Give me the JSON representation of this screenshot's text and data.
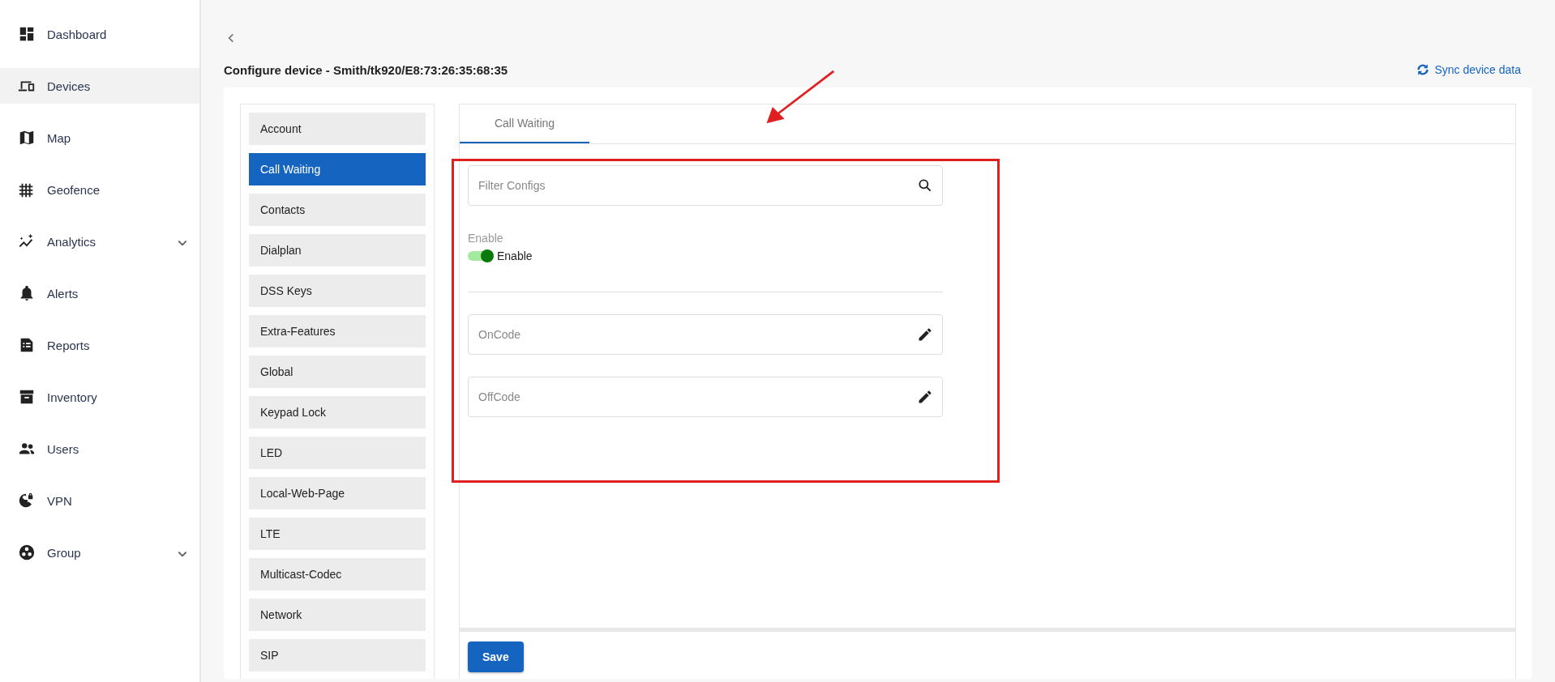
{
  "sidebar": {
    "items": [
      {
        "label": "Dashboard",
        "kind": "dashboard",
        "selected": false,
        "expandable": false
      },
      {
        "label": "Devices",
        "kind": "devices",
        "selected": true,
        "expandable": false
      },
      {
        "label": "Map",
        "kind": "map",
        "selected": false,
        "expandable": false
      },
      {
        "label": "Geofence",
        "kind": "geofence",
        "selected": false,
        "expandable": false
      },
      {
        "label": "Analytics",
        "kind": "analytics",
        "selected": false,
        "expandable": true
      },
      {
        "label": "Alerts",
        "kind": "alerts",
        "selected": false,
        "expandable": false
      },
      {
        "label": "Reports",
        "kind": "reports",
        "selected": false,
        "expandable": false
      },
      {
        "label": "Inventory",
        "kind": "inventory",
        "selected": false,
        "expandable": false
      },
      {
        "label": "Users",
        "kind": "users",
        "selected": false,
        "expandable": false
      },
      {
        "label": "VPN",
        "kind": "vpn",
        "selected": false,
        "expandable": false
      },
      {
        "label": "Group",
        "kind": "group",
        "selected": false,
        "expandable": true
      }
    ]
  },
  "header": {
    "title": "Configure device - Smith/tk920/E8:73:26:35:68:35",
    "sync_link": "Sync device data"
  },
  "config_menu": {
    "items": [
      {
        "label": "Account",
        "selected": false
      },
      {
        "label": "Call Waiting",
        "selected": true
      },
      {
        "label": "Contacts",
        "selected": false
      },
      {
        "label": "Dialplan",
        "selected": false
      },
      {
        "label": "DSS Keys",
        "selected": false
      },
      {
        "label": "Extra-Features",
        "selected": false
      },
      {
        "label": "Global",
        "selected": false
      },
      {
        "label": "Keypad Lock",
        "selected": false
      },
      {
        "label": "LED",
        "selected": false
      },
      {
        "label": "Local-Web-Page",
        "selected": false
      },
      {
        "label": "LTE",
        "selected": false
      },
      {
        "label": "Multicast-Codec",
        "selected": false
      },
      {
        "label": "Network",
        "selected": false
      },
      {
        "label": "SIP",
        "selected": false
      }
    ]
  },
  "tabs": [
    {
      "label": "Call Waiting",
      "selected": true
    }
  ],
  "filter": {
    "placeholder": "Filter Configs"
  },
  "enable": {
    "label": "Enable",
    "toggle_label": "Enable",
    "on": true
  },
  "fields": [
    {
      "placeholder": "OnCode"
    },
    {
      "placeholder": "OffCode"
    }
  ],
  "save_button": "Save"
}
